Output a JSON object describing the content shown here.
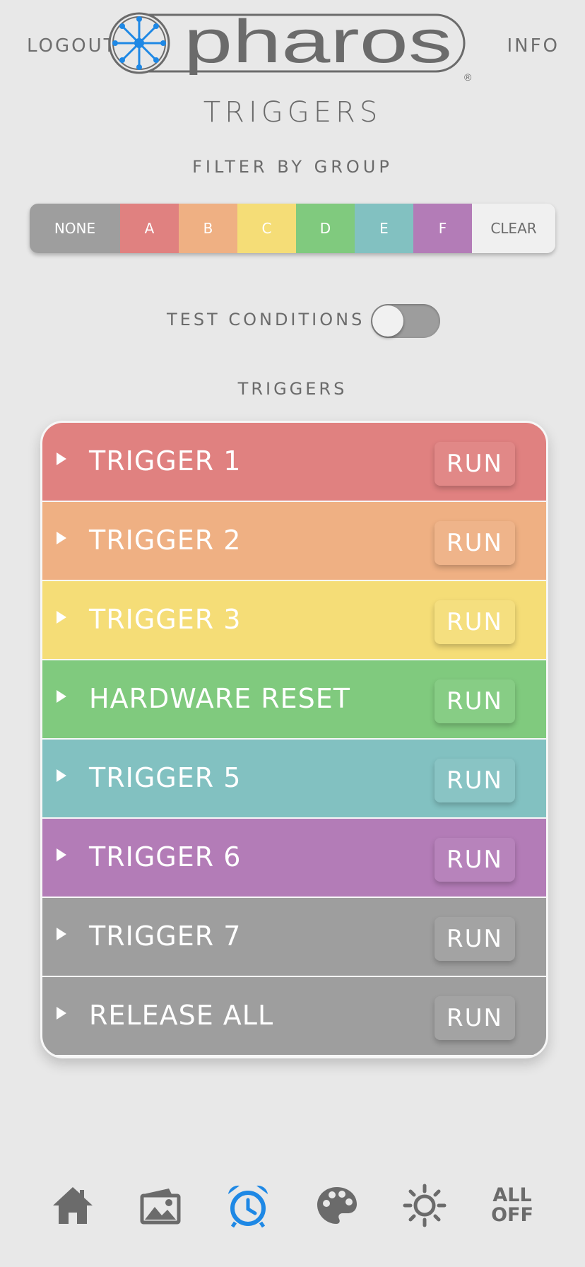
{
  "header": {
    "logout_label": "LOGOUT",
    "info_label": "INFO",
    "logo_text": "pharos",
    "logo_mark": "®",
    "page_title": "TRIGGERS"
  },
  "filter": {
    "label": "FILTER BY GROUP",
    "groups": [
      {
        "label": "NONE",
        "color": "#9e9e9e"
      },
      {
        "label": "A",
        "color": "#e08180"
      },
      {
        "label": "B",
        "color": "#efb083"
      },
      {
        "label": "C",
        "color": "#f5dd77"
      },
      {
        "label": "D",
        "color": "#80ca7e"
      },
      {
        "label": "E",
        "color": "#82c1c1"
      },
      {
        "label": "F",
        "color": "#b37cb7"
      }
    ],
    "clear_label": "CLEAR"
  },
  "test_conditions": {
    "label": "TEST CONDITIONS",
    "enabled": false
  },
  "triggers": {
    "label": "TRIGGERS",
    "items": [
      {
        "name": "TRIGGER 1",
        "run_label": "RUN",
        "color": "#e08180"
      },
      {
        "name": "TRIGGER 2",
        "run_label": "RUN",
        "color": "#efb083"
      },
      {
        "name": "TRIGGER 3",
        "run_label": "RUN",
        "color": "#f5dd77"
      },
      {
        "name": "HARDWARE RESET",
        "run_label": "RUN",
        "color": "#80ca7e"
      },
      {
        "name": "TRIGGER 5",
        "run_label": "RUN",
        "color": "#82c1c1"
      },
      {
        "name": "TRIGGER 6",
        "run_label": "RUN",
        "color": "#b37cb7"
      },
      {
        "name": "TRIGGER 7",
        "run_label": "RUN",
        "color": "#9e9e9e"
      },
      {
        "name": "RELEASE ALL",
        "run_label": "RUN",
        "color": "#9e9e9e"
      }
    ]
  },
  "nav": {
    "items": [
      {
        "icon": "home-icon",
        "active": false
      },
      {
        "icon": "gallery-icon",
        "active": false
      },
      {
        "icon": "alarm-clock-icon",
        "active": true
      },
      {
        "icon": "palette-icon",
        "active": false
      },
      {
        "icon": "brightness-icon",
        "active": false
      },
      {
        "icon": "all-off",
        "active": false
      }
    ],
    "all_off_line1": "ALL",
    "all_off_line2": "OFF",
    "active_color": "#1e88e5",
    "inactive_color": "#6b6b6b"
  },
  "brand_color": "#1e88e5"
}
